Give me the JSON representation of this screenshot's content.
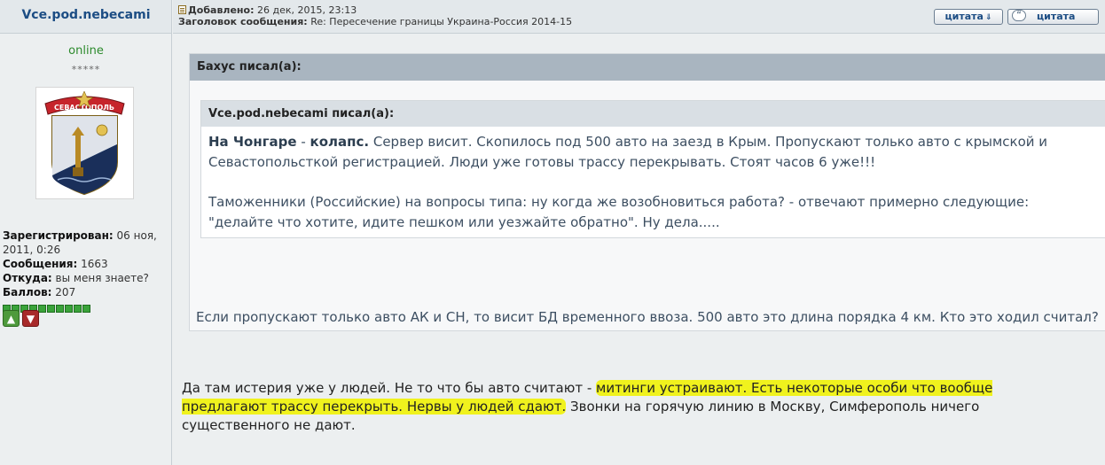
{
  "post": {
    "author": "Vce.pod.nebecami",
    "added_label": "Добавлено:",
    "added_value": "26 дек, 2015, 23:13",
    "subject_label": "Заголовок сообщения:",
    "subject_value": "Re: Пересечение границы Украина-Россия 2014-15",
    "quote_button": "цитата",
    "multiquote_button": "цитата"
  },
  "user": {
    "status": "online",
    "stars": "*****",
    "registered_label": "Зарегистрирован:",
    "registered_value": "06 ноя, 2011, 0:26",
    "messages_label": "Сообщения:",
    "messages_value": "1663",
    "from_label": "Откуда:",
    "from_value": "вы меня знаете?",
    "points_label": "Баллов:",
    "points_value": "207",
    "reputation_count": 10,
    "avatar_text": "СЕВАСТОПОЛЬ"
  },
  "quote_outer": {
    "header": "Бахус писал(а):",
    "body": "Если пропускают только авто АК и СН, то висит БД временного ввоза. 500 авто это длина порядка 4 км. Кто это ходил считал?"
  },
  "quote_inner": {
    "header": "Vce.pod.nebecami писал(а):",
    "bold_1": "На Чонгаре",
    "sep": " - ",
    "bold_2": "колапс.",
    "text_1": " Сервер висит. Скопилось под 500 авто на заезд в Крым. Пропускают только авто с крымской и Севастопольсткой регистрацией. Люди уже готовы трассу перекрывать. Стоят часов 6 уже!!!",
    "text_2": "Таможенники (Российские) на вопросы типа: ну когда же возобновиться работа? - отвечают примерно следующие: \"делайте что хотите, идите пешком или уезжайте обратно\". Ну дела....."
  },
  "reply": {
    "part_1": "Да там истерия уже у людей. Не то что бы авто считают - ",
    "highlight": "митинги устраивают. Есть некоторые особи что вообще предлагают трассу перекрыть. Нервы у людей сдают.",
    "part_2": " Звонки на горячую линию в Москву, Симферополь ничего существенного не дают.",
    "highlight_color": "#f0f21d"
  }
}
